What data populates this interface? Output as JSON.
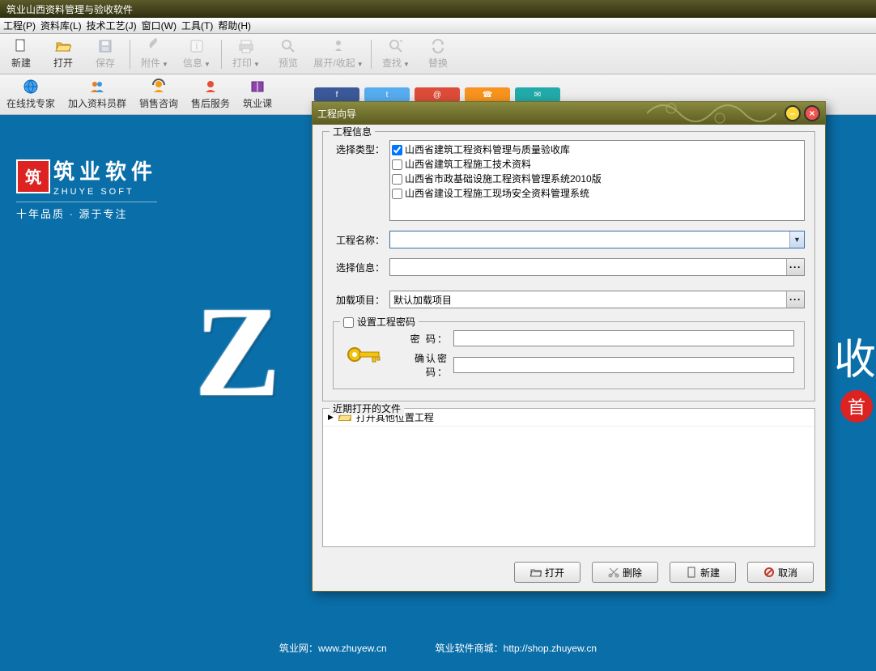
{
  "app": {
    "title": "筑业山西资料管理与验收软件"
  },
  "menubar": {
    "items": [
      "工程(P)",
      "资料库(L)",
      "技术工艺(J)",
      "窗口(W)",
      "工具(T)",
      "帮助(H)"
    ]
  },
  "toolbar": {
    "new": "新建",
    "open": "打开",
    "save": "保存",
    "attach": "附件",
    "info": "信息",
    "print": "打印",
    "preview": "预览",
    "expand": "展开/收起",
    "find": "查找",
    "replace": "替换"
  },
  "toolbar2": {
    "expert": "在线找专家",
    "group": "加入资料员群",
    "sales": "销售咨询",
    "service": "售后服务",
    "course": "筑业课"
  },
  "brand": {
    "mark": "筑",
    "name": "筑业软件",
    "py": "ZHUYE SOFT",
    "slogan": "十年品质 · 源于专注"
  },
  "side": {
    "text": "收",
    "badge": "首"
  },
  "footer": {
    "l_label": "筑业网：",
    "l_url": "www.zhuyew.cn",
    "r_label": "筑业软件商城：",
    "r_url": "http://shop.zhuyew.cn"
  },
  "dialog": {
    "title": "工程向导",
    "group_info": "工程信息",
    "label_type": "选择类型：",
    "types": [
      {
        "label": "山西省建筑工程资料管理与质量验收库",
        "checked": true
      },
      {
        "label": "山西省建筑工程施工技术资料",
        "checked": false
      },
      {
        "label": "山西省市政基础设施工程资料管理系统2010版",
        "checked": false
      },
      {
        "label": "山西省建设工程施工现场安全资料管理系统",
        "checked": false
      }
    ],
    "label_name": "工程名称：",
    "name_value": "",
    "label_selinfo": "选择信息：",
    "selinfo_value": "",
    "label_load": "加载项目：",
    "load_value": "默认加载项目",
    "pw_legend": "设置工程密码",
    "pw_label": "密    码：",
    "pw2_label": "确认密码：",
    "recent_title": "近期打开的文件",
    "recent_item": "打开其他位置工程",
    "btn_open": "打开",
    "btn_delete": "删除",
    "btn_new": "新建",
    "btn_cancel": "取消"
  }
}
